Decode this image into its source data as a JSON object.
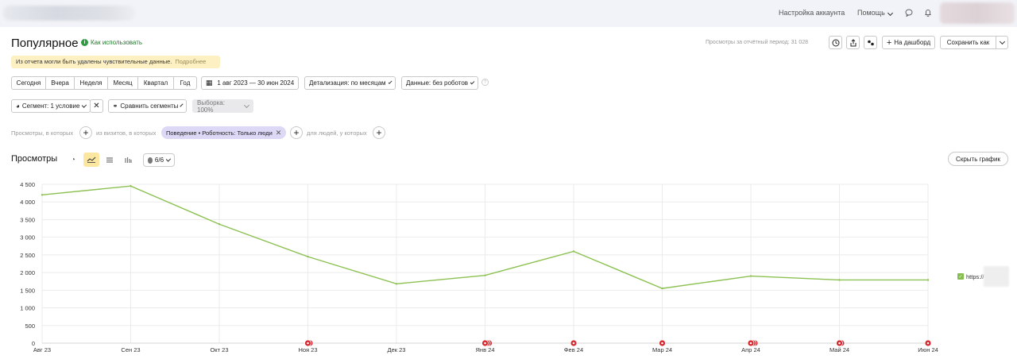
{
  "topbar": {
    "account_settings": "Настройка аккаунта",
    "help": "Помощь"
  },
  "header": {
    "title": "Популярное",
    "how_to_use": "Как использовать",
    "views_period": "Просмотры за отчётный период: 31 028",
    "to_dashboard": "На дашборд",
    "save_as": "Сохранить как"
  },
  "warning": {
    "text": "Из отчета могли быть удалены чувствительные данные.",
    "more": "Подробнее"
  },
  "periods": [
    "Сегодня",
    "Вчера",
    "Неделя",
    "Месяц",
    "Квартал",
    "Год"
  ],
  "date_range": "1 авг 2023 — 30 июн 2024",
  "detail": "Детализация: по месяцам",
  "data_mode": "Данные: без роботов",
  "segment": {
    "label": "Сегмент: 1 условие",
    "compare": "Сравнить сегменты",
    "sample": "Выборка: 100%"
  },
  "filters": {
    "views_where": "Просмотры, в которых",
    "visits_where": "из визитов, в которых",
    "chip": "Поведение • Роботность: Только люди",
    "people_where": "для людей, у которых"
  },
  "chart_header": {
    "title": "Просмотры",
    "metrics": "6/6",
    "hide_chart": "Скрыть график"
  },
  "legend": {
    "series": "https://"
  },
  "colors": {
    "line": "#8cc152",
    "grid": "#ebebeb",
    "marker": "#d8262d",
    "warning": "#fdf1c4",
    "active": "#fbe7a0"
  },
  "chart_data": {
    "type": "line",
    "categories": [
      "Авг 23",
      "Сен 23",
      "Окт 23",
      "Ноя 23",
      "Дек 23",
      "Янв 24",
      "Фев 24",
      "Мар 24",
      "Апр 24",
      "Май 24",
      "Июн 24"
    ],
    "y_ticks": [
      "0",
      "500",
      "1 000",
      "1 500",
      "2 000",
      "2 500",
      "3 000",
      "3 500",
      "4 000",
      "4 500"
    ],
    "ylim": [
      0,
      4500
    ],
    "grid": true,
    "legend": "right",
    "series": [
      {
        "name": "https://",
        "values": [
          4200,
          4450,
          3370,
          2450,
          1680,
          1920,
          2600,
          1550,
          1900,
          1790,
          1790
        ]
      }
    ],
    "annotation_counts": [
      0,
      0,
      0,
      2,
      0,
      3,
      1,
      1,
      3,
      2,
      1
    ]
  }
}
